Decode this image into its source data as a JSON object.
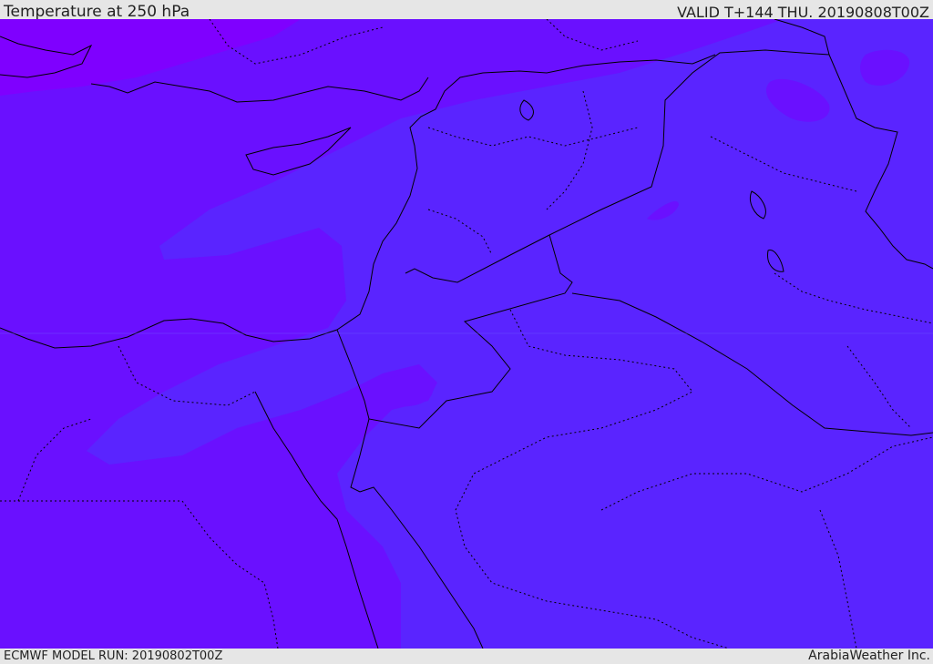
{
  "header": {
    "title": "Temperature at 250 hPa",
    "valid": "VALID T+144 THU. 20190808T00Z"
  },
  "footer": {
    "model_run": "ECMWF MODEL RUN: 20190802T00Z",
    "credit": "ArabiaWeather Inc."
  },
  "colors": {
    "coldest": "#7f00ff",
    "colder": "#6a10ff",
    "cold": "#5a24ff",
    "boundary": "#000000"
  }
}
